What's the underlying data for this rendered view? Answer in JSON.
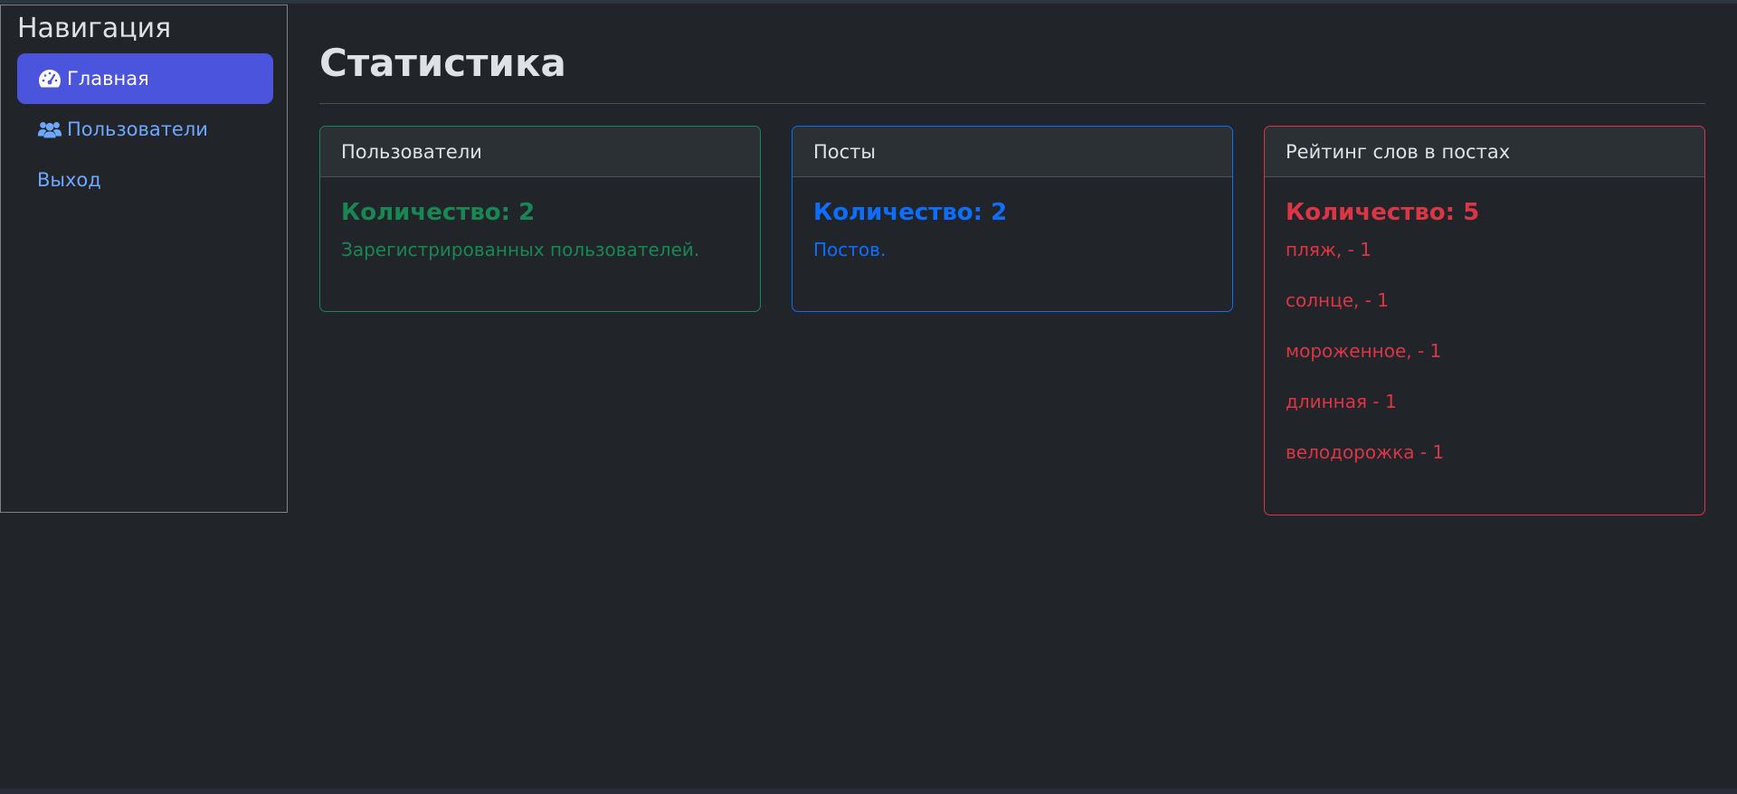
{
  "sidebar": {
    "title": "Навигация",
    "items": [
      {
        "label": "Главная",
        "icon": "tachometer-icon",
        "active": true
      },
      {
        "label": "Пользователи",
        "icon": "users-icon",
        "active": false
      },
      {
        "label": "Выход",
        "icon": "",
        "active": false
      }
    ]
  },
  "main": {
    "title": "Статистика",
    "cards": [
      {
        "header": "Пользователи",
        "count": "Количество: 2",
        "text": "Зарегистрированных пользователей.",
        "color": "#198754"
      },
      {
        "header": "Посты",
        "count": "Количество: 2",
        "text": "Постов.",
        "color": "#0d6efd"
      },
      {
        "header": "Рейтинг слов в постах",
        "count": "Количество: 5",
        "color": "#dc3545",
        "words": [
          "пляж, - 1",
          "солнце, - 1",
          "мороженное, - 1",
          "длинная - 1",
          "велодорожка - 1"
        ]
      }
    ]
  }
}
